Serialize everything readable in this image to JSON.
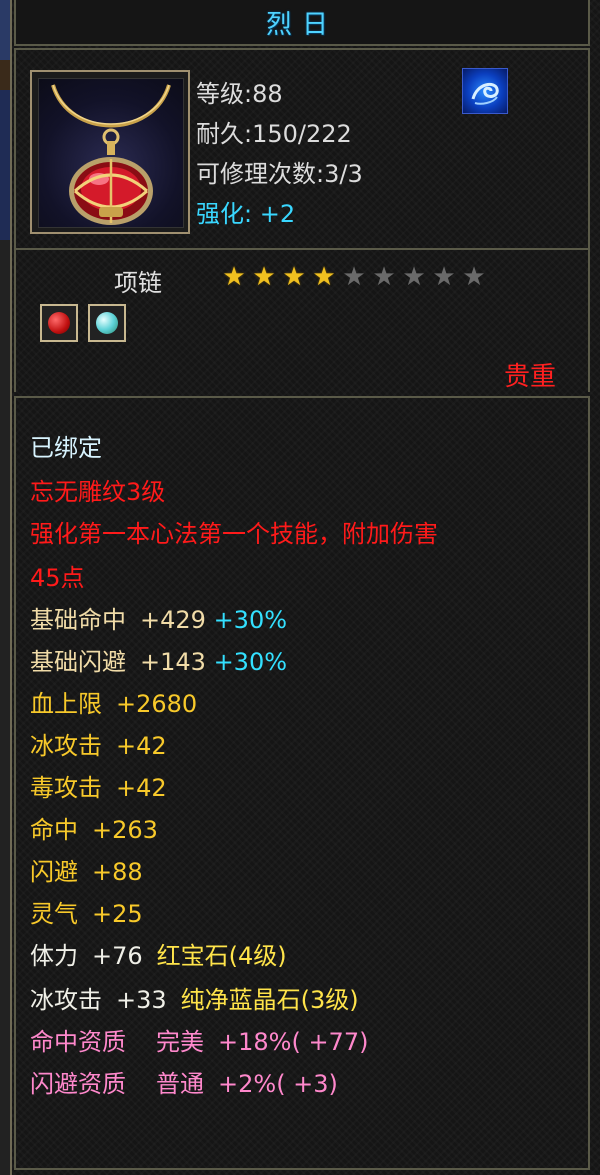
{
  "item": {
    "name": "烈日",
    "level_label": "等级:88",
    "durability_label": "耐久:150/222",
    "repair_label": "可修理次数:3/3",
    "enhance_label": "强化: +2",
    "type": "项链",
    "stars": {
      "filled": 4,
      "total": 9
    },
    "rarity": "贵重"
  },
  "gems": [
    {
      "icon": "ruby-gem-icon",
      "color": "#c01010"
    },
    {
      "icon": "sapphire-gem-icon",
      "color": "#5fd3d8"
    }
  ],
  "description": {
    "bound": "已绑定",
    "engrave": "忘无雕纹3级",
    "skill_line1": "强化第一本心法第一个技能，附加伤害",
    "skill_line2": "45点",
    "base_attrs": [
      {
        "name": "基础命中",
        "value": "+429",
        "bonus": "+30%"
      },
      {
        "name": "基础闪避",
        "value": "+143",
        "bonus": "+30%"
      }
    ],
    "attrs": [
      {
        "name": "血上限",
        "value": "+2680"
      },
      {
        "name": "冰攻击",
        "value": "+42"
      },
      {
        "name": "毒攻击",
        "value": "+42"
      },
      {
        "name": "命中",
        "value": "+263"
      },
      {
        "name": "闪避",
        "value": "+88"
      },
      {
        "name": "灵气",
        "value": "+25"
      }
    ],
    "gem_attrs": [
      {
        "name": "体力",
        "value": "+76",
        "gem": "红宝石(4级)"
      },
      {
        "name": "冰攻击",
        "value": "+33",
        "gem": "纯净蓝晶石(3级)"
      }
    ],
    "aptitudes": [
      {
        "name": "命中资质",
        "grade": "完美",
        "value": "+18%",
        "extra": "( +77)"
      },
      {
        "name": "闪避资质",
        "grade": "普通",
        "value": "+2%",
        "extra": "( +3)"
      }
    ]
  },
  "colors": {
    "title": "#4fd3ff",
    "rarity": "#ff2020",
    "enhance": "#39d7ff",
    "star_on": "#f0c020"
  }
}
